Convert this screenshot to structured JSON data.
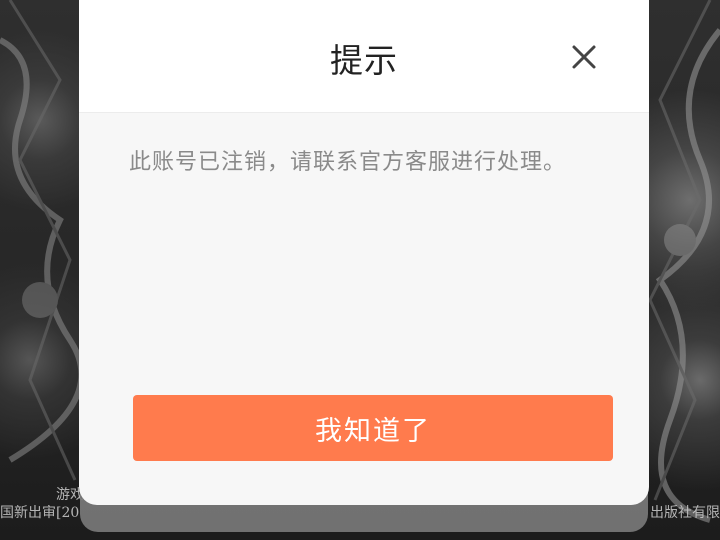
{
  "dialog": {
    "title": "提示",
    "message": "此账号已注销，请联系官方客服进行处理。",
    "confirm_label": "我知道了",
    "close_icon": "close-icon"
  },
  "background": {
    "footer_line1": "游戏",
    "footer_line2": "国新出审[20",
    "footer_line2_right": "出版社有限",
    "footer_line3": "    "
  },
  "colors": {
    "accent": "#ff7b4d",
    "dialog_bg": "#f7f7f7",
    "header_bg": "#ffffff",
    "overlay": "#2a2a2a"
  }
}
